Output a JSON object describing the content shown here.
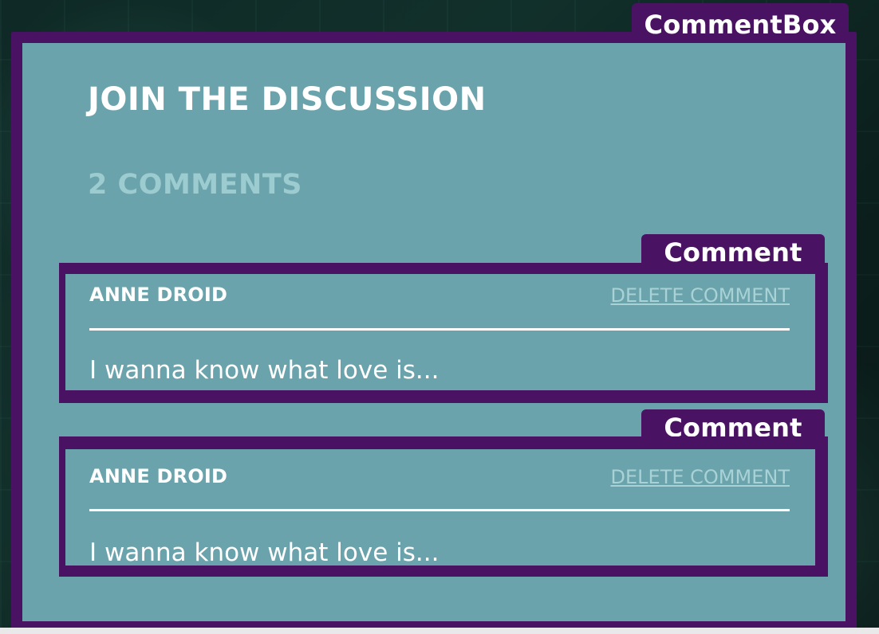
{
  "labels": {
    "comment_box": "CommentBox",
    "comment": "Comment"
  },
  "header": {
    "title": "JOIN THE DISCUSSION",
    "count": "2 COMMENTS"
  },
  "comments": [
    {
      "author": "ANNE DROID",
      "delete_label": "DELETE COMMENT",
      "text": "I wanna know what love is..."
    },
    {
      "author": "ANNE DROID",
      "delete_label": "DELETE COMMENT",
      "text": "I wanna know what love is..."
    }
  ],
  "colors": {
    "frame": "#4a1263",
    "panel": "#6aa3ab",
    "muted_text": "#9ccbd0"
  }
}
